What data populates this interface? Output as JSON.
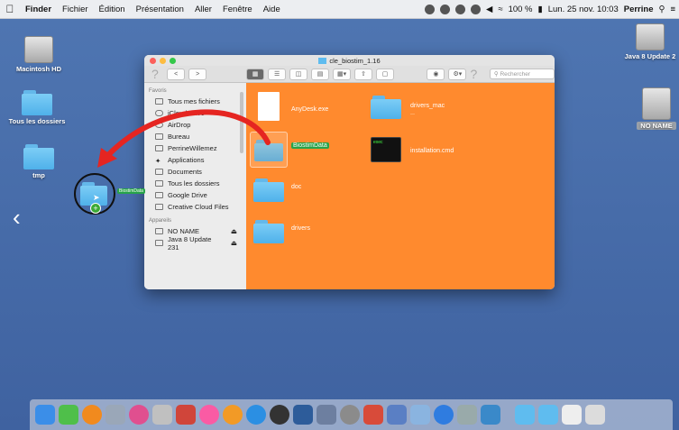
{
  "menubar": {
    "app": "Finder",
    "items": [
      "Fichier",
      "Édition",
      "Présentation",
      "Aller",
      "Fenêtre",
      "Aide"
    ],
    "battery": "100 %",
    "datetime": "Lun. 25 nov. 10:03",
    "user": "Perrine"
  },
  "desktop": {
    "icons": {
      "hd": "Macintosh HD",
      "all_folders": "Tous les dossiers",
      "tmp": "tmp",
      "java": "Java 8 Update 2",
      "noname": "NO NAME"
    },
    "drag_label": "BiostimData"
  },
  "window": {
    "title": "cle_biostim_1.16",
    "search_placeholder": "Rechercher",
    "sidebar": {
      "favorites_header": "Favoris",
      "favorites": [
        "Tous mes fichiers",
        "iCloud Drive",
        "AirDrop",
        "Bureau",
        "PerrineWillemez",
        "Applications",
        "Documents",
        "Tous les dossiers",
        "Google Drive",
        "Creative Cloud Files"
      ],
      "devices_header": "Appareils",
      "devices": [
        "NO NAME",
        "Java 8 Update 231"
      ]
    },
    "files": {
      "anydesk": "AnyDesk.exe",
      "drivers_mac": "drivers_mac",
      "biostim": "BiostimData",
      "install": "installation.cmd",
      "doc": "doc",
      "drivers": "drivers"
    }
  },
  "colors": {
    "desktop": "#4a6ea7",
    "finder_content": "#ff8a2e",
    "arrow": "#e52521",
    "folder": "#5fbcef"
  }
}
